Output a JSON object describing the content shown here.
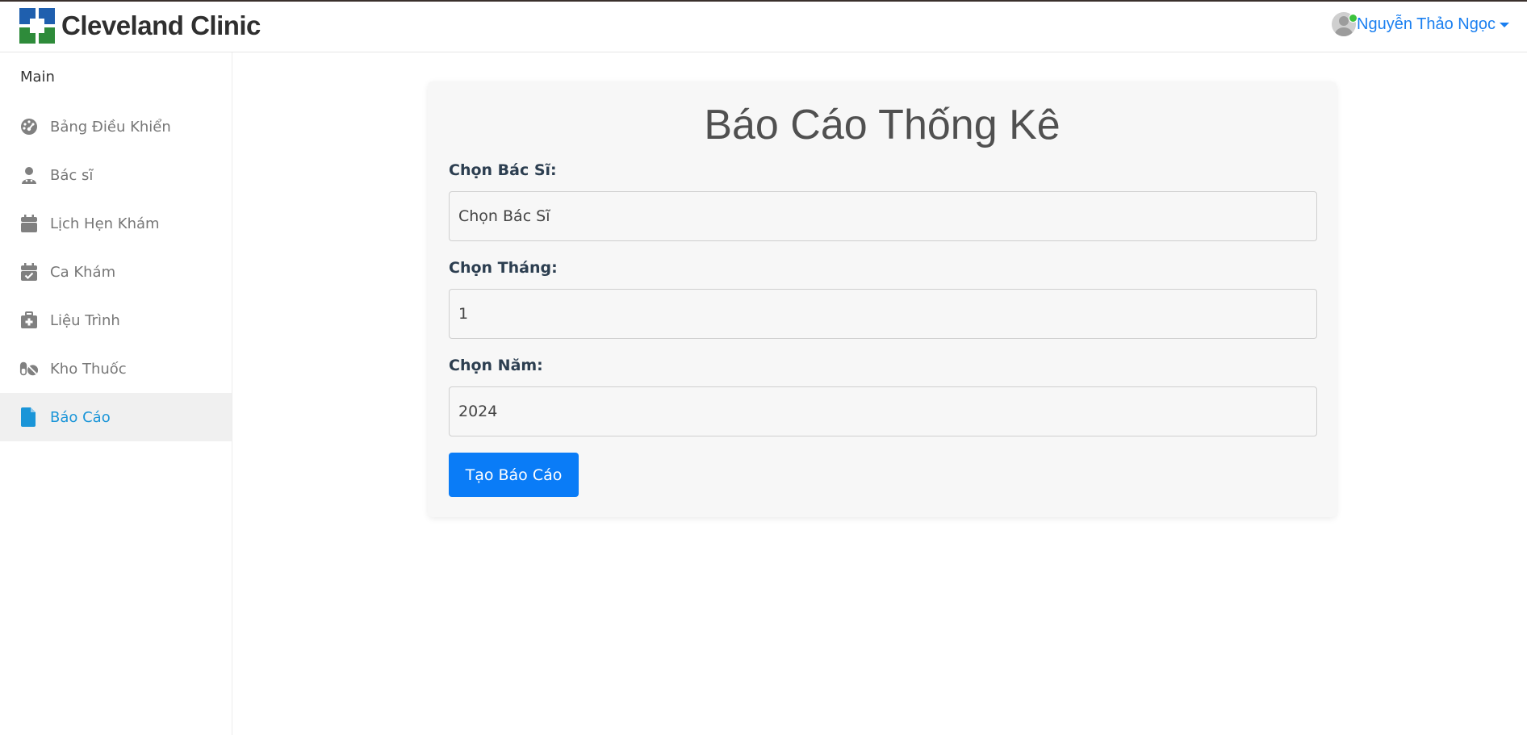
{
  "header": {
    "logo_text": "Cleveland Clinic",
    "user_name": "Nguyễn Thảo Ngọc"
  },
  "sidebar": {
    "section_title": "Main",
    "items": [
      {
        "label": "Bảng Điều Khiển",
        "icon": "dashboard-icon"
      },
      {
        "label": "Bác sĩ",
        "icon": "doctor-icon"
      },
      {
        "label": "Lịch Hẹn Khám",
        "icon": "calendar-icon"
      },
      {
        "label": "Ca Khám",
        "icon": "calendar-check-icon"
      },
      {
        "label": "Liệu Trình",
        "icon": "medical-kit-icon"
      },
      {
        "label": "Kho Thuốc",
        "icon": "pills-icon"
      },
      {
        "label": "Báo Cáo",
        "icon": "file-icon",
        "active": true
      }
    ]
  },
  "report": {
    "title": "Báo Cáo Thống Kê",
    "doctor_label": "Chọn Bác Sĩ:",
    "doctor_value": "Chọn Bác Sĩ",
    "month_label": "Chọn Tháng:",
    "month_value": "1",
    "year_label": "Chọn Năm:",
    "year_value": "2024",
    "submit_label": "Tạo Báo Cáo"
  },
  "colors": {
    "accent": "#0a7cf7",
    "active_menu_text": "#1a95d8",
    "user_link": "#1a7ff0",
    "online": "#3cc23c"
  }
}
